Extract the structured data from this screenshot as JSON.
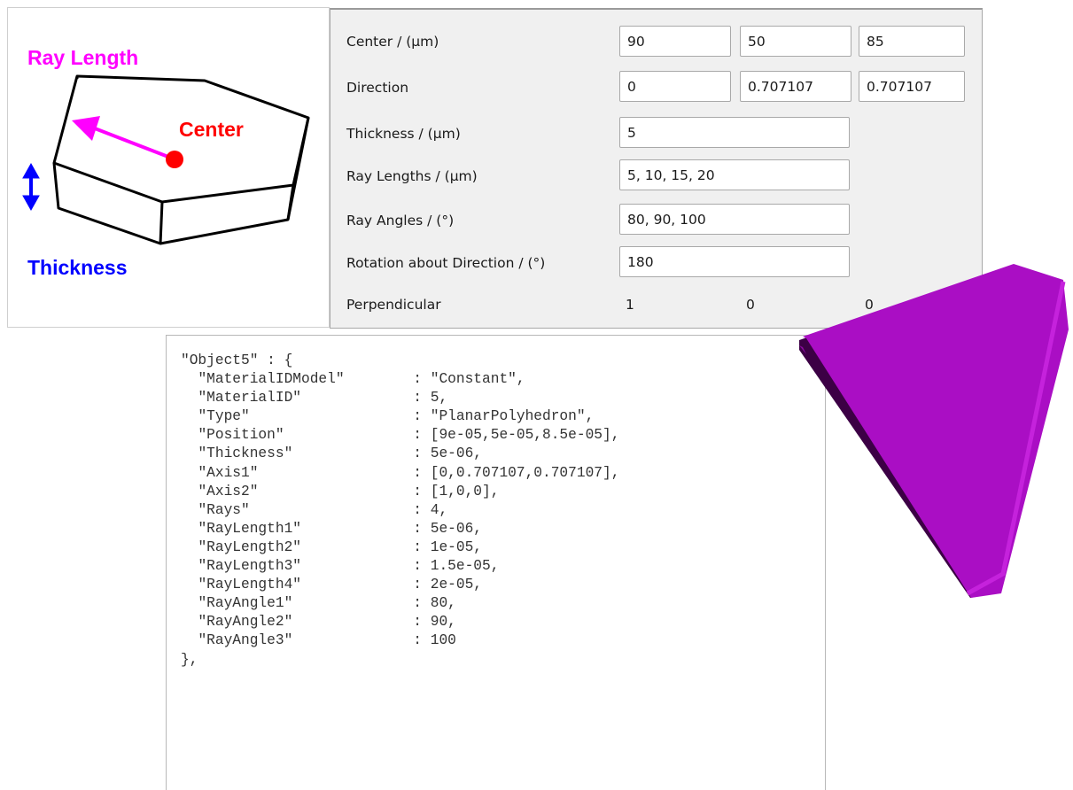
{
  "diagram": {
    "ray_length_label": "Ray Length",
    "center_label": "Center",
    "thickness_label": "Thickness",
    "colors": {
      "ray": "#ff00ff",
      "center": "#ff0000",
      "thickness": "#0000ff",
      "outline": "#000000"
    }
  },
  "form": {
    "center": {
      "label": "Center / (µm)",
      "x": "90",
      "y": "50",
      "z": "85"
    },
    "direction": {
      "label": "Direction",
      "x": "0",
      "y": "0.707107",
      "z": "0.707107"
    },
    "thickness": {
      "label": "Thickness / (µm)",
      "value": "5"
    },
    "ray_lengths": {
      "label": "Ray Lengths / (µm)",
      "value": "5, 10, 15, 20"
    },
    "ray_angles": {
      "label": "Ray Angles / (°)",
      "value": "80, 90, 100"
    },
    "rotation": {
      "label": "Rotation about Direction / (°)",
      "value": "180"
    },
    "perpendicular": {
      "label": "Perpendicular",
      "x": "1",
      "y": "0",
      "z": "0"
    }
  },
  "code": {
    "open": "\"Object5\" : {",
    "lines": [
      {
        "key": "\"MaterialIDModel\"",
        "value": ": \"Constant\","
      },
      {
        "key": "\"MaterialID\"",
        "value": ": 5,"
      },
      {
        "key": "\"Type\"",
        "value": ": \"PlanarPolyhedron\","
      },
      {
        "key": "\"Position\"",
        "value": ": [9e-05,5e-05,8.5e-05],"
      },
      {
        "key": "\"Thickness\"",
        "value": ": 5e-06,"
      },
      {
        "key": "\"Axis1\"",
        "value": ": [0,0.707107,0.707107],"
      },
      {
        "key": "\"Axis2\"",
        "value": ": [1,0,0],"
      },
      {
        "key": "\"Rays\"",
        "value": ": 4,"
      },
      {
        "key": "\"RayLength1\"",
        "value": ": 5e-06,"
      },
      {
        "key": "\"RayLength2\"",
        "value": ": 1e-05,"
      },
      {
        "key": "\"RayLength3\"",
        "value": ": 1.5e-05,"
      },
      {
        "key": "\"RayLength4\"",
        "value": ": 2e-05,"
      },
      {
        "key": "\"RayAngle1\"",
        "value": ": 80,"
      },
      {
        "key": "\"RayAngle2\"",
        "value": ": 90,"
      },
      {
        "key": "\"RayAngle3\"",
        "value": ": 100"
      }
    ],
    "close": "},"
  },
  "render": {
    "colors": {
      "top": "#aa0ec4",
      "left": "#8a0aa0",
      "front": "#3c0045",
      "edge": "#c522dc"
    }
  }
}
